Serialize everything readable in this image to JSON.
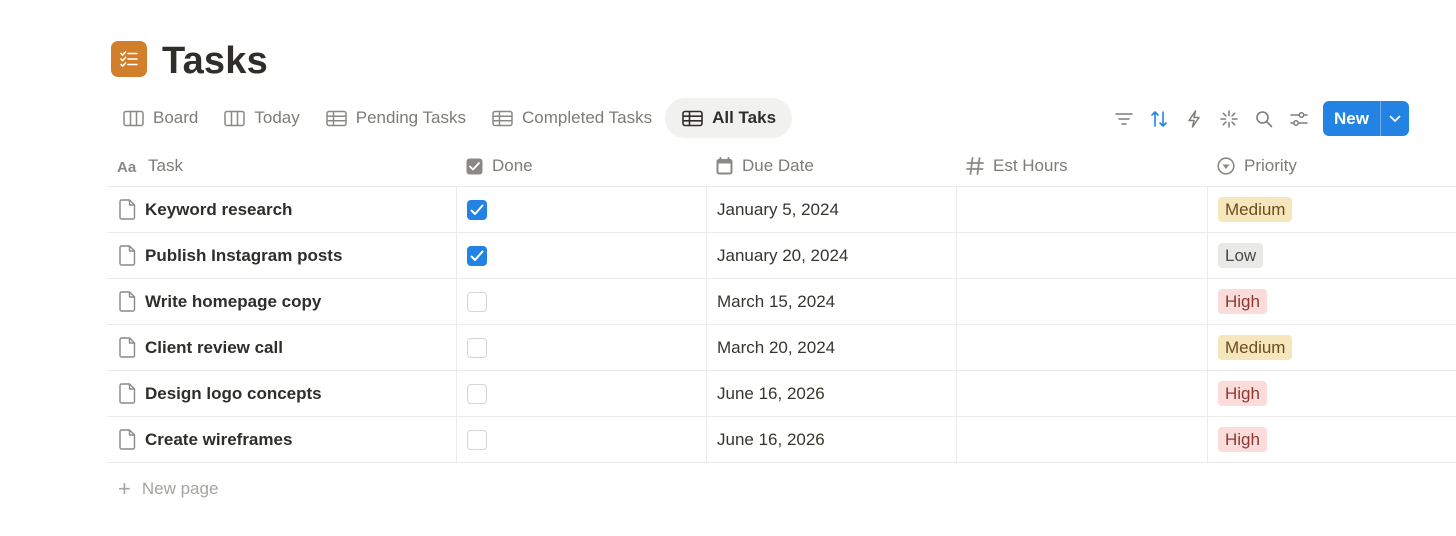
{
  "page": {
    "title": "Tasks",
    "icon": "checklist-icon",
    "icon_color": "#d27f2c"
  },
  "tabs": [
    {
      "label": "Board",
      "icon": "board-icon",
      "active": false
    },
    {
      "label": "Today",
      "icon": "board-icon",
      "active": false
    },
    {
      "label": "Pending Tasks",
      "icon": "table-icon",
      "active": false
    },
    {
      "label": "Completed Tasks",
      "icon": "table-icon",
      "active": false
    },
    {
      "label": "All Taks",
      "icon": "table-icon",
      "active": true
    }
  ],
  "toolbar": {
    "tools": [
      "filter-icon",
      "sort-icon",
      "automation-icon",
      "ai-sparkle-icon",
      "search-icon",
      "settings-sliders-icon"
    ],
    "new_label": "New",
    "accent": "#2383e2"
  },
  "columns": [
    {
      "label": "Task",
      "icon": "text-type-icon"
    },
    {
      "label": "Done",
      "icon": "checkbox-icon"
    },
    {
      "label": "Due Date",
      "icon": "calendar-icon"
    },
    {
      "label": "Est Hours",
      "icon": "hash-icon"
    },
    {
      "label": "Priority",
      "icon": "status-icon"
    }
  ],
  "rows": [
    {
      "task": "Keyword research",
      "done": true,
      "due": "January 5, 2024",
      "est_hours": "",
      "priority": "Medium"
    },
    {
      "task": "Publish Instagram posts",
      "done": true,
      "due": "January 20, 2024",
      "est_hours": "",
      "priority": "Low"
    },
    {
      "task": "Write homepage copy",
      "done": false,
      "due": "March 15, 2024",
      "est_hours": "",
      "priority": "High"
    },
    {
      "task": "Client review call",
      "done": false,
      "due": "March 20, 2024",
      "est_hours": "",
      "priority": "Medium"
    },
    {
      "task": "Design logo concepts",
      "done": false,
      "due": "June 16, 2026",
      "est_hours": "",
      "priority": "High"
    },
    {
      "task": "Create wireframes",
      "done": false,
      "due": "June 16, 2026",
      "est_hours": "",
      "priority": "High"
    }
  ],
  "priority_colors": {
    "Medium": {
      "bg": "#f6e6bb",
      "fg": "#6b4c1f"
    },
    "Low": {
      "bg": "#e9e9e7",
      "fg": "#4a4945"
    },
    "High": {
      "bg": "#fbdcdb",
      "fg": "#8a3a33"
    }
  },
  "new_page": {
    "label": "New page"
  }
}
